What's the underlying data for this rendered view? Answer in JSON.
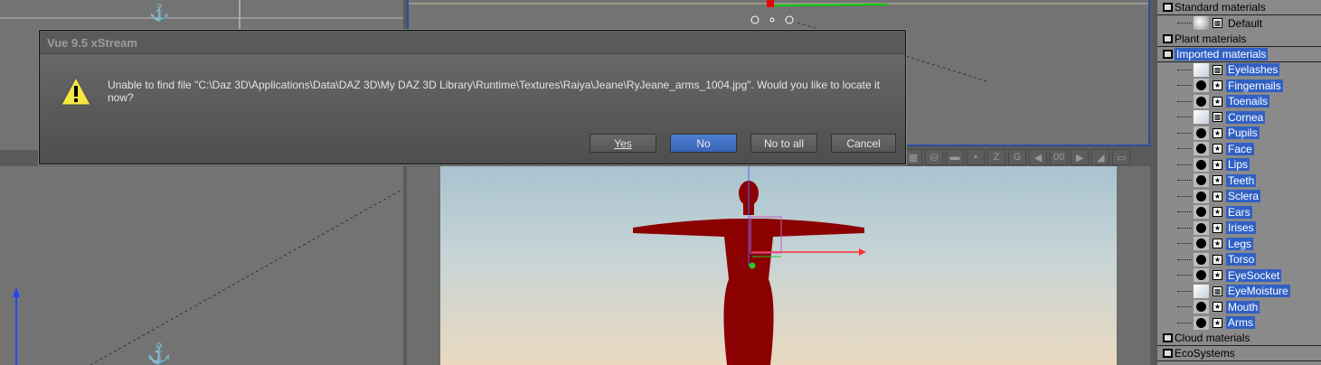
{
  "dialog": {
    "title": "Vue 9.5 xStream",
    "message": "Unable to find file \"C:\\Daz 3D\\Applications\\Data\\DAZ 3D\\My DAZ 3D Library\\Runtime\\Textures\\Raiya\\Jeane\\RyJeane_arms_1004.jpg\". Would you like to locate it now?",
    "buttons": {
      "yes": "Yes",
      "no": "No",
      "no_to_all": "No to all",
      "cancel": "Cancel"
    }
  },
  "toolbar": {
    "axis_label": "Z",
    "frame": "00"
  },
  "materials": {
    "groups": {
      "standard": "Standard materials",
      "plant": "Plant materials",
      "imported": "Imported materials",
      "cloud": "Cloud materials",
      "eco": "EcoSystems"
    },
    "standard_items": [
      {
        "name": "Default"
      }
    ],
    "imported_items": [
      {
        "name": "Eyelashes",
        "type": "mixed"
      },
      {
        "name": "Fingernails",
        "type": "star"
      },
      {
        "name": "Toenails",
        "type": "star"
      },
      {
        "name": "Cornea",
        "type": "mixed"
      },
      {
        "name": "Pupils",
        "type": "star"
      },
      {
        "name": "Face",
        "type": "star"
      },
      {
        "name": "Lips",
        "type": "star"
      },
      {
        "name": "Teeth",
        "type": "star"
      },
      {
        "name": "Sclera",
        "type": "star"
      },
      {
        "name": "Ears",
        "type": "star"
      },
      {
        "name": "Irises",
        "type": "star"
      },
      {
        "name": "Legs",
        "type": "star"
      },
      {
        "name": "Torso",
        "type": "star"
      },
      {
        "name": "EyeSocket",
        "type": "star"
      },
      {
        "name": "EyeMoisture",
        "type": "mixed"
      },
      {
        "name": "Mouth",
        "type": "star"
      },
      {
        "name": "Arms",
        "type": "star"
      }
    ]
  },
  "colors": {
    "selection": "#3160c4",
    "figure": "#8b0000"
  }
}
